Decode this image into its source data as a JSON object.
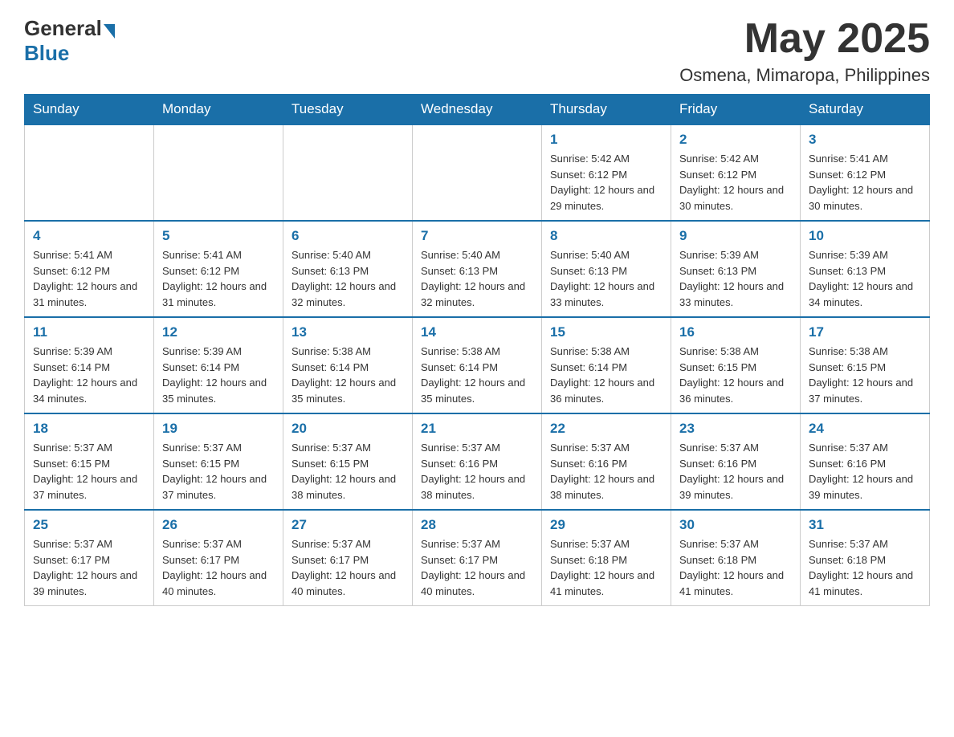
{
  "header": {
    "logo": {
      "general": "General",
      "blue": "Blue"
    },
    "month_title": "May 2025",
    "location": "Osmena, Mimaropa, Philippines"
  },
  "days_of_week": [
    "Sunday",
    "Monday",
    "Tuesday",
    "Wednesday",
    "Thursday",
    "Friday",
    "Saturday"
  ],
  "weeks": [
    [
      {
        "day": "",
        "info": ""
      },
      {
        "day": "",
        "info": ""
      },
      {
        "day": "",
        "info": ""
      },
      {
        "day": "",
        "info": ""
      },
      {
        "day": "1",
        "info": "Sunrise: 5:42 AM\nSunset: 6:12 PM\nDaylight: 12 hours and 29 minutes."
      },
      {
        "day": "2",
        "info": "Sunrise: 5:42 AM\nSunset: 6:12 PM\nDaylight: 12 hours and 30 minutes."
      },
      {
        "day": "3",
        "info": "Sunrise: 5:41 AM\nSunset: 6:12 PM\nDaylight: 12 hours and 30 minutes."
      }
    ],
    [
      {
        "day": "4",
        "info": "Sunrise: 5:41 AM\nSunset: 6:12 PM\nDaylight: 12 hours and 31 minutes."
      },
      {
        "day": "5",
        "info": "Sunrise: 5:41 AM\nSunset: 6:12 PM\nDaylight: 12 hours and 31 minutes."
      },
      {
        "day": "6",
        "info": "Sunrise: 5:40 AM\nSunset: 6:13 PM\nDaylight: 12 hours and 32 minutes."
      },
      {
        "day": "7",
        "info": "Sunrise: 5:40 AM\nSunset: 6:13 PM\nDaylight: 12 hours and 32 minutes."
      },
      {
        "day": "8",
        "info": "Sunrise: 5:40 AM\nSunset: 6:13 PM\nDaylight: 12 hours and 33 minutes."
      },
      {
        "day": "9",
        "info": "Sunrise: 5:39 AM\nSunset: 6:13 PM\nDaylight: 12 hours and 33 minutes."
      },
      {
        "day": "10",
        "info": "Sunrise: 5:39 AM\nSunset: 6:13 PM\nDaylight: 12 hours and 34 minutes."
      }
    ],
    [
      {
        "day": "11",
        "info": "Sunrise: 5:39 AM\nSunset: 6:14 PM\nDaylight: 12 hours and 34 minutes."
      },
      {
        "day": "12",
        "info": "Sunrise: 5:39 AM\nSunset: 6:14 PM\nDaylight: 12 hours and 35 minutes."
      },
      {
        "day": "13",
        "info": "Sunrise: 5:38 AM\nSunset: 6:14 PM\nDaylight: 12 hours and 35 minutes."
      },
      {
        "day": "14",
        "info": "Sunrise: 5:38 AM\nSunset: 6:14 PM\nDaylight: 12 hours and 35 minutes."
      },
      {
        "day": "15",
        "info": "Sunrise: 5:38 AM\nSunset: 6:14 PM\nDaylight: 12 hours and 36 minutes."
      },
      {
        "day": "16",
        "info": "Sunrise: 5:38 AM\nSunset: 6:15 PM\nDaylight: 12 hours and 36 minutes."
      },
      {
        "day": "17",
        "info": "Sunrise: 5:38 AM\nSunset: 6:15 PM\nDaylight: 12 hours and 37 minutes."
      }
    ],
    [
      {
        "day": "18",
        "info": "Sunrise: 5:37 AM\nSunset: 6:15 PM\nDaylight: 12 hours and 37 minutes."
      },
      {
        "day": "19",
        "info": "Sunrise: 5:37 AM\nSunset: 6:15 PM\nDaylight: 12 hours and 37 minutes."
      },
      {
        "day": "20",
        "info": "Sunrise: 5:37 AM\nSunset: 6:15 PM\nDaylight: 12 hours and 38 minutes."
      },
      {
        "day": "21",
        "info": "Sunrise: 5:37 AM\nSunset: 6:16 PM\nDaylight: 12 hours and 38 minutes."
      },
      {
        "day": "22",
        "info": "Sunrise: 5:37 AM\nSunset: 6:16 PM\nDaylight: 12 hours and 38 minutes."
      },
      {
        "day": "23",
        "info": "Sunrise: 5:37 AM\nSunset: 6:16 PM\nDaylight: 12 hours and 39 minutes."
      },
      {
        "day": "24",
        "info": "Sunrise: 5:37 AM\nSunset: 6:16 PM\nDaylight: 12 hours and 39 minutes."
      }
    ],
    [
      {
        "day": "25",
        "info": "Sunrise: 5:37 AM\nSunset: 6:17 PM\nDaylight: 12 hours and 39 minutes."
      },
      {
        "day": "26",
        "info": "Sunrise: 5:37 AM\nSunset: 6:17 PM\nDaylight: 12 hours and 40 minutes."
      },
      {
        "day": "27",
        "info": "Sunrise: 5:37 AM\nSunset: 6:17 PM\nDaylight: 12 hours and 40 minutes."
      },
      {
        "day": "28",
        "info": "Sunrise: 5:37 AM\nSunset: 6:17 PM\nDaylight: 12 hours and 40 minutes."
      },
      {
        "day": "29",
        "info": "Sunrise: 5:37 AM\nSunset: 6:18 PM\nDaylight: 12 hours and 41 minutes."
      },
      {
        "day": "30",
        "info": "Sunrise: 5:37 AM\nSunset: 6:18 PM\nDaylight: 12 hours and 41 minutes."
      },
      {
        "day": "31",
        "info": "Sunrise: 5:37 AM\nSunset: 6:18 PM\nDaylight: 12 hours and 41 minutes."
      }
    ]
  ]
}
